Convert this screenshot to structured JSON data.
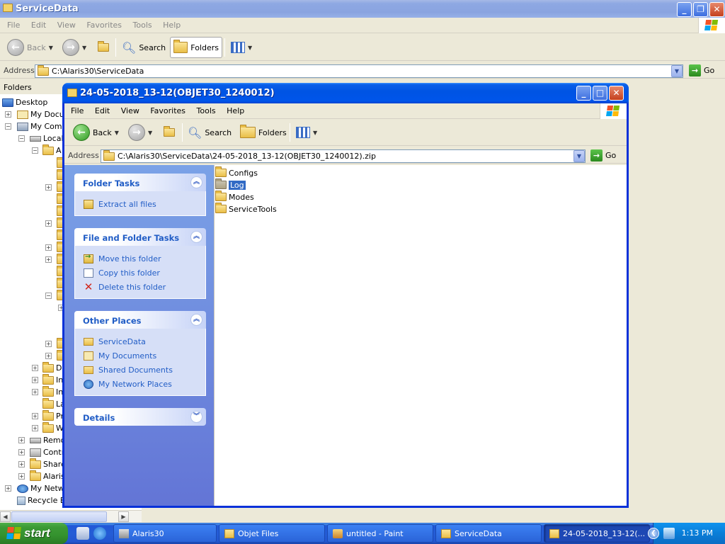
{
  "back_window": {
    "title": "ServiceData",
    "menu": [
      "File",
      "Edit",
      "View",
      "Favorites",
      "Tools",
      "Help"
    ],
    "toolbar": {
      "back": "Back",
      "search": "Search",
      "folders": "Folders"
    },
    "address_label": "Address",
    "address": "C:\\Alaris30\\ServiceData",
    "go": "Go",
    "folders_bar": "Folders",
    "tree": [
      {
        "label": "Desktop"
      },
      {
        "label": "My Docun"
      },
      {
        "label": "My Compu"
      },
      {
        "label": "Local"
      },
      {
        "label": "A"
      },
      {
        "label": "D"
      },
      {
        "label": "In"
      },
      {
        "label": "In"
      },
      {
        "label": "La"
      },
      {
        "label": "Pr"
      },
      {
        "label": "W"
      },
      {
        "label": "Remo"
      },
      {
        "label": "Contr"
      },
      {
        "label": "Share"
      },
      {
        "label": "Alaris"
      },
      {
        "label": "My Netwo"
      },
      {
        "label": "Recycle B"
      }
    ]
  },
  "front_window": {
    "title": "24-05-2018_13-12(OBJET30_1240012)",
    "menu": [
      "File",
      "Edit",
      "View",
      "Favorites",
      "Tools",
      "Help"
    ],
    "toolbar": {
      "back": "Back",
      "search": "Search",
      "folders": "Folders"
    },
    "address_label": "Address",
    "address": "C:\\Alaris30\\ServiceData\\24-05-2018_13-12(OBJET30_1240012).zip",
    "go": "Go",
    "tasks": {
      "folder_tasks": {
        "title": "Folder Tasks",
        "items": [
          "Extract all files"
        ]
      },
      "file_folder_tasks": {
        "title": "File and Folder Tasks",
        "items": [
          "Move this folder",
          "Copy this folder",
          "Delete this folder"
        ]
      },
      "other_places": {
        "title": "Other Places",
        "items": [
          "ServiceData",
          "My Documents",
          "Shared Documents",
          "My Network Places"
        ]
      },
      "details": {
        "title": "Details"
      }
    },
    "files": [
      {
        "name": "Configs",
        "selected": false
      },
      {
        "name": "Log",
        "selected": true
      },
      {
        "name": "Modes",
        "selected": false
      },
      {
        "name": "ServiceTools",
        "selected": false
      }
    ]
  },
  "taskbar": {
    "start": "start",
    "items": [
      {
        "label": "Alaris30"
      },
      {
        "label": "Objet Files"
      },
      {
        "label": "untitled - Paint"
      },
      {
        "label": "ServiceData"
      },
      {
        "label": "24-05-2018_13-12(..."
      }
    ],
    "clock": "1:13 PM"
  },
  "colors": {
    "xp_blue": "#0054e3",
    "task_link": "#215dc6",
    "selection": "#316ac5",
    "start_green": "#3c9a35"
  }
}
